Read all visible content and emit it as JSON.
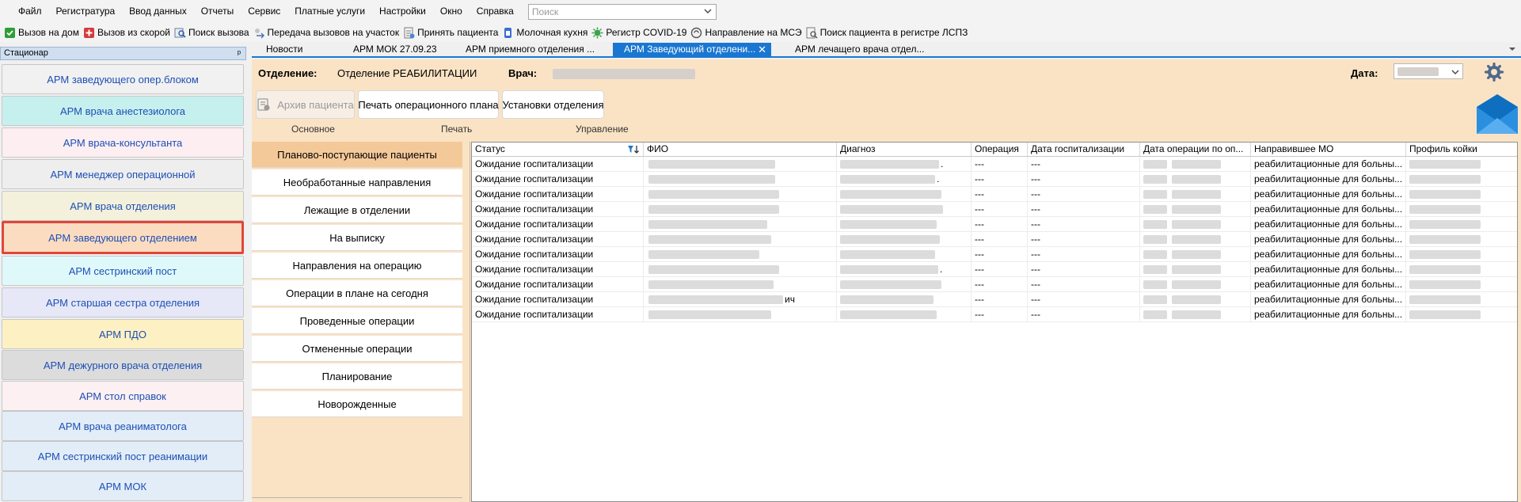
{
  "menu": {
    "items": [
      "Файл",
      "Регистратура",
      "Ввод данных",
      "Отчеты",
      "Сервис",
      "Платные услуги",
      "Настройки",
      "Окно",
      "Справка"
    ],
    "search_placeholder": "Поиск"
  },
  "toolbar": {
    "items": [
      {
        "label": "Вызов на дом",
        "icon": "check-icon"
      },
      {
        "label": "Вызов из скорой",
        "icon": "ambulance-icon"
      },
      {
        "label": "Поиск вызова",
        "icon": "search-call-icon"
      },
      {
        "label": "Передача вызовов на участок",
        "icon": "transfer-icon"
      },
      {
        "label": "Принять пациента",
        "icon": "accept-patient-icon"
      },
      {
        "label": "Молочная кухня",
        "icon": "milk-icon"
      },
      {
        "label": "Регистр COVID-19",
        "icon": "virus-icon"
      },
      {
        "label": "Направление на МСЭ",
        "icon": "mse-icon"
      },
      {
        "label": "Поиск пациента в регистре ЛСПЗ",
        "icon": "registry-search-icon"
      }
    ]
  },
  "left_panel": {
    "title": "Стационар",
    "pin": "ᵖ",
    "items": [
      {
        "label": "АРМ заведующего опер.блоком",
        "color": "#f1f1f1"
      },
      {
        "label": "АРМ врача анестезиолога",
        "color": "#c6f0ee"
      },
      {
        "label": "АРМ врача-консультанта",
        "color": "#fdeef2"
      },
      {
        "label": "АРМ менеджер  операционной",
        "color": "#eeeeee"
      },
      {
        "label": "АРМ врача отделения",
        "color": "#f3f1dc"
      },
      {
        "label": "АРМ заведующего отделением",
        "color": "#fcdcc0",
        "active": true
      },
      {
        "label": "АРМ сестринский пост",
        "color": "#dff9fb"
      },
      {
        "label": "АРМ старшая сестра отделения",
        "color": "#e6e8f7"
      },
      {
        "label": "АРМ ПДО",
        "color": "#fdf0c3"
      },
      {
        "label": "АРМ дежурного врача отделения",
        "color": "#dcdcdc"
      },
      {
        "label": "АРМ стол справок",
        "color": "#fdf0f2"
      },
      {
        "label": "АРМ врача реаниматолога",
        "color": "#e2edf8"
      },
      {
        "label": "АРМ сестринский пост реанимации",
        "color": "#e2edf8"
      },
      {
        "label": "АРМ МОК",
        "color": "#e2edf8"
      }
    ]
  },
  "tabs": [
    {
      "label": "Новости"
    },
    {
      "label": "АРМ МОК 27.09.23"
    },
    {
      "label": "АРМ приемного отделения ..."
    },
    {
      "label": "АРМ Заведующий отделени...",
      "active": true,
      "close": "✕"
    },
    {
      "label": "АРМ лечащего врача отдел..."
    }
  ],
  "header": {
    "department_label": "Отделение:",
    "department_value": "Отделение РЕАБИЛИТАЦИИ",
    "doctor_label": "Врач:",
    "date_label": "Дата:"
  },
  "actions": {
    "archive": "Архив пациента",
    "print_plan": "Печать операционного плана",
    "settings": "Установки отделения",
    "groups": [
      "Основное",
      "Печать",
      "Управление"
    ]
  },
  "subnav": {
    "items": [
      {
        "label": "Планово-поступающие пациенты",
        "active": true
      },
      {
        "label": "Необработанные направления"
      },
      {
        "label": "Лежащие в отделении"
      },
      {
        "label": "На выписку"
      },
      {
        "label": "Направления на операцию"
      },
      {
        "label": "Операции в плане на сегодня"
      },
      {
        "label": "Проведенные операции"
      },
      {
        "label": "Отмененные операции"
      },
      {
        "label": "Планирование"
      },
      {
        "label": "Новорожденные"
      }
    ]
  },
  "grid": {
    "columns": [
      "Статус",
      "ФИО",
      "Диагноз",
      "Операция",
      "Дата госпитализации",
      "Дата операции по оп...",
      "Направившее МО",
      "Профиль койки"
    ],
    "rows": [
      {
        "status": "Ожидание госпитализации",
        "fio_suffix": "",
        "diag_suffix": ".",
        "op": "---",
        "hosp": "---",
        "mo": "реабилитационные для больны..."
      },
      {
        "status": "Ожидание госпитализации",
        "fio_suffix": "",
        "diag_suffix": ".",
        "op": "---",
        "hosp": "---",
        "mo": "реабилитационные для больны..."
      },
      {
        "status": "Ожидание госпитализации",
        "fio_suffix": "",
        "diag_suffix": "",
        "op": "---",
        "hosp": "---",
        "mo": "реабилитационные для больны..."
      },
      {
        "status": "Ожидание госпитализации",
        "fio_suffix": "",
        "diag_suffix": "",
        "op": "---",
        "hosp": "---",
        "mo": "реабилитационные для больны..."
      },
      {
        "status": "Ожидание госпитализации",
        "fio_suffix": "",
        "diag_suffix": "",
        "op": "---",
        "hosp": "---",
        "mo": "реабилитационные для больны..."
      },
      {
        "status": "Ожидание госпитализации",
        "fio_suffix": "",
        "diag_suffix": "",
        "op": "---",
        "hosp": "---",
        "mo": "реабилитационные для больны..."
      },
      {
        "status": "Ожидание госпитализации",
        "fio_suffix": "",
        "diag_suffix": "",
        "op": "---",
        "hosp": "---",
        "mo": "реабилитационные для больны..."
      },
      {
        "status": "Ожидание госпитализации",
        "fio_suffix": "",
        "diag_suffix": ".",
        "op": "---",
        "hosp": "---",
        "mo": "реабилитационные для больны..."
      },
      {
        "status": "Ожидание госпитализации",
        "fio_suffix": "",
        "diag_suffix": "",
        "op": "---",
        "hosp": "---",
        "mo": "реабилитационные для больны..."
      },
      {
        "status": "Ожидание госпитализации",
        "fio_suffix": "ич",
        "diag_suffix": "",
        "op": "---",
        "hosp": "---",
        "mo": "реабилитационные для больны..."
      },
      {
        "status": "Ожидание госпитализации",
        "fio_suffix": "",
        "diag_suffix": "",
        "op": "---",
        "hosp": "---",
        "mo": "реабилитационные для больны..."
      }
    ]
  },
  "colors": {
    "accent": "#1a77d1",
    "main_bg": "#fae3c5",
    "active_sub": "#f4c99a",
    "link_blue": "#1e4fb5",
    "active_border": "#e0463a"
  }
}
